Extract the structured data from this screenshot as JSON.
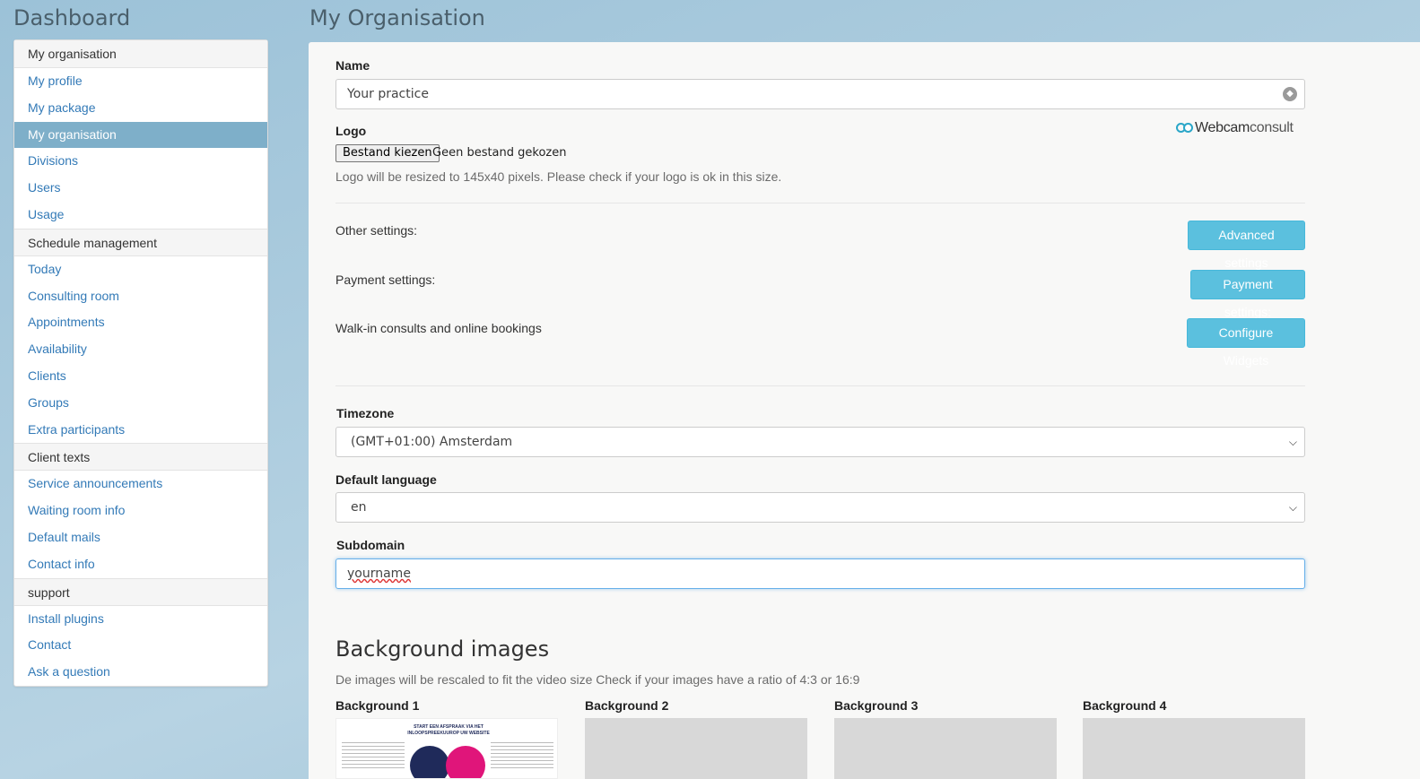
{
  "header": {
    "dashboard_title": "Dashboard",
    "page_title": "My Organisation"
  },
  "sidebar": {
    "sections": [
      {
        "label": "My organisation",
        "items": [
          {
            "label": "My profile"
          },
          {
            "label": "My package"
          },
          {
            "label": "My organisation",
            "active": true
          },
          {
            "label": "Divisions"
          },
          {
            "label": "Users"
          },
          {
            "label": "Usage"
          }
        ]
      },
      {
        "label": "Schedule management",
        "items": [
          {
            "label": "Today"
          },
          {
            "label": "Consulting room"
          },
          {
            "label": "Appointments"
          },
          {
            "label": "Availability"
          },
          {
            "label": "Clients"
          },
          {
            "label": "Groups"
          },
          {
            "label": "Extra participants"
          }
        ]
      },
      {
        "label": "Client texts",
        "items": [
          {
            "label": "Service announcements"
          },
          {
            "label": "Waiting room info"
          },
          {
            "label": "Default mails"
          },
          {
            "label": "Contact info"
          }
        ]
      },
      {
        "label": "support",
        "items": [
          {
            "label": "Install plugins"
          },
          {
            "label": "Contact"
          },
          {
            "label": "Ask a question"
          }
        ]
      }
    ]
  },
  "form": {
    "name_label": "Name",
    "name_value": "Your practice",
    "logo_label": "Logo",
    "logo_brand_part1": "Webcam",
    "logo_brand_part2": "consult",
    "file_button": "Bestand kiezen",
    "file_status": "Geen bestand gekozen",
    "logo_hint": "Logo will be resized to 145x40 pixels. Please check if your logo is ok in this size.",
    "other_settings_label": "Other settings:",
    "advanced_settings_button": "Advanced settings",
    "payment_settings_label": "Payment settings:",
    "payment_settings_button": "Payment settings:",
    "walkin_label": "Walk-in consults and online bookings",
    "configure_widgets_button": "Configure Widgets",
    "timezone_label": "Timezone",
    "timezone_value": "(GMT+01:00) Amsterdam",
    "language_label": "Default language",
    "language_value": "en",
    "subdomain_label": "Subdomain",
    "subdomain_value": "yourname"
  },
  "backgrounds": {
    "heading": "Background images",
    "hint": "De images will be rescaled to fit the video size Check if your images have a ratio of 4:3 or 16:9",
    "items": [
      {
        "label": "Background 1",
        "thumb_title": "START EEN AFSPRAAK VIA HET INLOOPSPREEKUUROP UW WEBSITE"
      },
      {
        "label": "Background 2"
      },
      {
        "label": "Background 3"
      },
      {
        "label": "Background 4"
      }
    ]
  },
  "colors": {
    "accent_button": "#5bc0de",
    "sidebar_active": "#7eafc9",
    "link": "#337ab7"
  }
}
